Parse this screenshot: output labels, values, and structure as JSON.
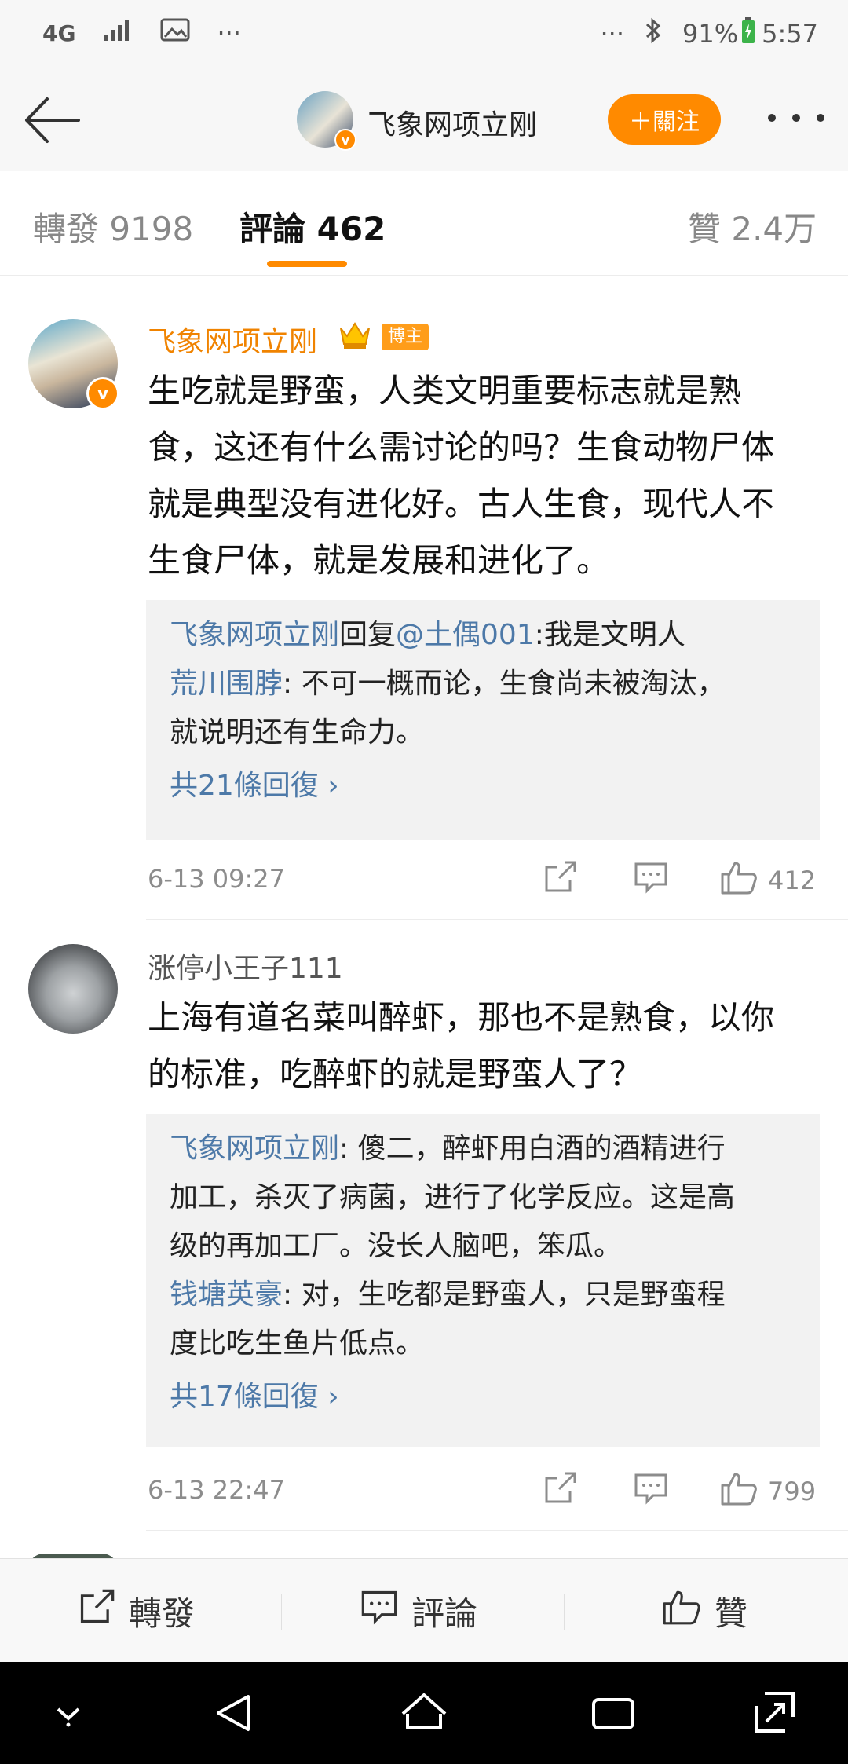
{
  "status_bar": {
    "network": "4G",
    "extra": "···",
    "extra_right": "···",
    "battery": "91%",
    "time": "5:57"
  },
  "header": {
    "title": "飞象网项立刚",
    "follow_label": "＋關注"
  },
  "tabs": {
    "reposts": "轉發 9198",
    "comments": "評論 462",
    "likes": "贊 2.4万"
  },
  "comments": [
    {
      "author": "飞象网项立刚",
      "badge": "博主",
      "body": [
        "生吃就是野蛮，人类文明重要标志就是熟",
        "食，这还有什么需讨论的吗？生食动物尸体",
        "就是典型没有进化好。古人生食，现代人不",
        "生食尸体，就是发展和进化了。"
      ],
      "replies": {
        "r1_user": "飞象网项立刚",
        "r1_mid": "回复",
        "r1_mention": "@土偶001",
        "r1_text": ":我是文明人",
        "r2_user": "荒川围脖",
        "r2_text_1": ": 不可一概而论，生食尚未被淘汰，",
        "r2_text_2": "就说明还有生命力。",
        "more": "共21條回復 ›"
      },
      "time": "6-13 09:27",
      "likes": "412"
    },
    {
      "author": "涨停小王子111",
      "body": [
        "上海有道名菜叫醉虾，那也不是熟食，以你",
        "的标准，吃醉虾的就是野蛮人了？"
      ],
      "replies": {
        "r1_user": "飞象网项立刚",
        "r1_text_1": ": 傻二，醉虾用白酒的酒精进行",
        "r1_text_2": "加工，杀灭了病菌，进行了化学反应。这是高",
        "r1_text_3": "级的再加工厂。没长人脑吧，笨瓜。",
        "r2_user": "钱塘英豪",
        "r2_text_1": ": 对，生吃都是野蛮人，只是野蛮程",
        "r2_text_2": "度比吃生鱼片低点。",
        "more": "共17條回復 ›"
      },
      "time": "6-13 22:47",
      "likes": "799"
    }
  ],
  "bottom_bar": {
    "repost": "轉發",
    "comment": "評論",
    "like": "贊"
  },
  "colors": {
    "accent": "#ff8a00",
    "link": "#4d79a8",
    "meta": "#8c8c8c"
  }
}
